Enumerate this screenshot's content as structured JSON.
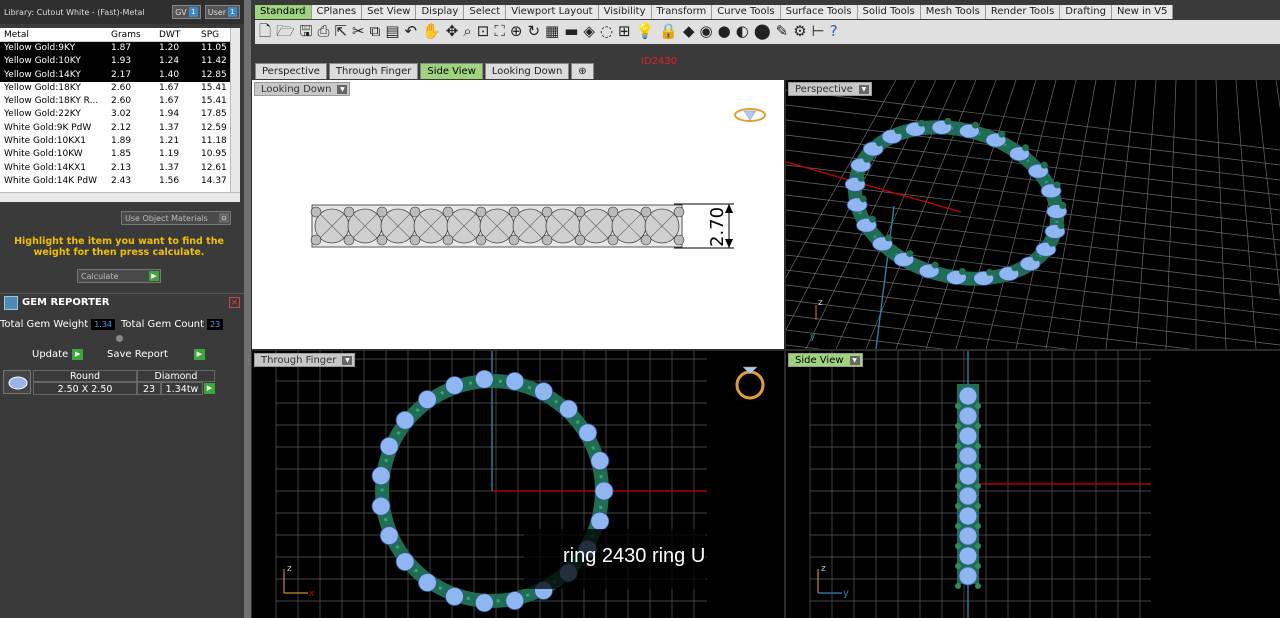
{
  "library": {
    "title": "Library: Cutout White - (Fast)-Metal",
    "toggle_gv": "GV",
    "toggle_user": "User",
    "toggle_num": "1"
  },
  "metal_table": {
    "headers": [
      "Metal",
      "Grams",
      "DWT",
      "SPG"
    ],
    "rows": [
      [
        "Yellow Gold:9KY",
        "1.87",
        "1.20",
        "11.05"
      ],
      [
        "Yellow Gold:10KY",
        "1.93",
        "1.24",
        "11.42"
      ],
      [
        "Yellow Gold:14KY",
        "2.17",
        "1.40",
        "12.85"
      ],
      [
        "Yellow Gold:18KY",
        "2.60",
        "1.67",
        "15.41"
      ],
      [
        "Yellow Gold:18KY R...",
        "2.60",
        "1.67",
        "15.41"
      ],
      [
        "Yellow Gold:22KY",
        "3.02",
        "1.94",
        "17.85"
      ],
      [
        "White Gold:9K PdW",
        "2.12",
        "1.37",
        "12.59"
      ],
      [
        "White Gold:10KX1",
        "1.89",
        "1.21",
        "11.18"
      ],
      [
        "White Gold:10KW",
        "1.85",
        "1.19",
        "10.95"
      ],
      [
        "White Gold:14KX1",
        "2.13",
        "1.37",
        "12.61"
      ],
      [
        "White Gold:14K PdW",
        "2.43",
        "1.56",
        "14.37"
      ]
    ]
  },
  "use_object_materials": "Use Object Materials",
  "hint": "Highlight the item you want to find the weight for then press calculate.",
  "calculate_label": "Calculate",
  "gem_reporter": {
    "title": "GEM REPORTER",
    "total_weight_label": "Total Gem Weight",
    "total_weight": "1.34",
    "total_count_label": "Total Gem Count",
    "total_count": "23",
    "update_label": "Update",
    "save_label": "Save Report",
    "col_shape": "Round",
    "col_type": "Diamond",
    "size": "2.50 X 2.50",
    "count": "23",
    "tw": "1.34tw"
  },
  "toolbar_tabs": [
    "Standard",
    "CPlanes",
    "Set View",
    "Display",
    "Select",
    "Viewport Layout",
    "Visibility",
    "Transform",
    "Curve Tools",
    "Surface Tools",
    "Solid Tools",
    "Mesh Tools",
    "Render Tools",
    "Drafting",
    "New in V5"
  ],
  "view_tabs": [
    "Perspective",
    "Through Finger",
    "Side View",
    "Looking Down"
  ],
  "id_label": "ID2430",
  "viewports": {
    "looking_down": "Looking Down",
    "perspective": "Perspective",
    "through_finger": "Through Finger",
    "side_view": "Side View"
  },
  "dimension": "2.70",
  "caption": "ring 2430 ring U",
  "colors": {
    "accent_green": "#9fd37e",
    "ring_green": "#1e6e52",
    "gem_blue": "#8fb6f0",
    "hint_yellow": "#f0c000"
  }
}
